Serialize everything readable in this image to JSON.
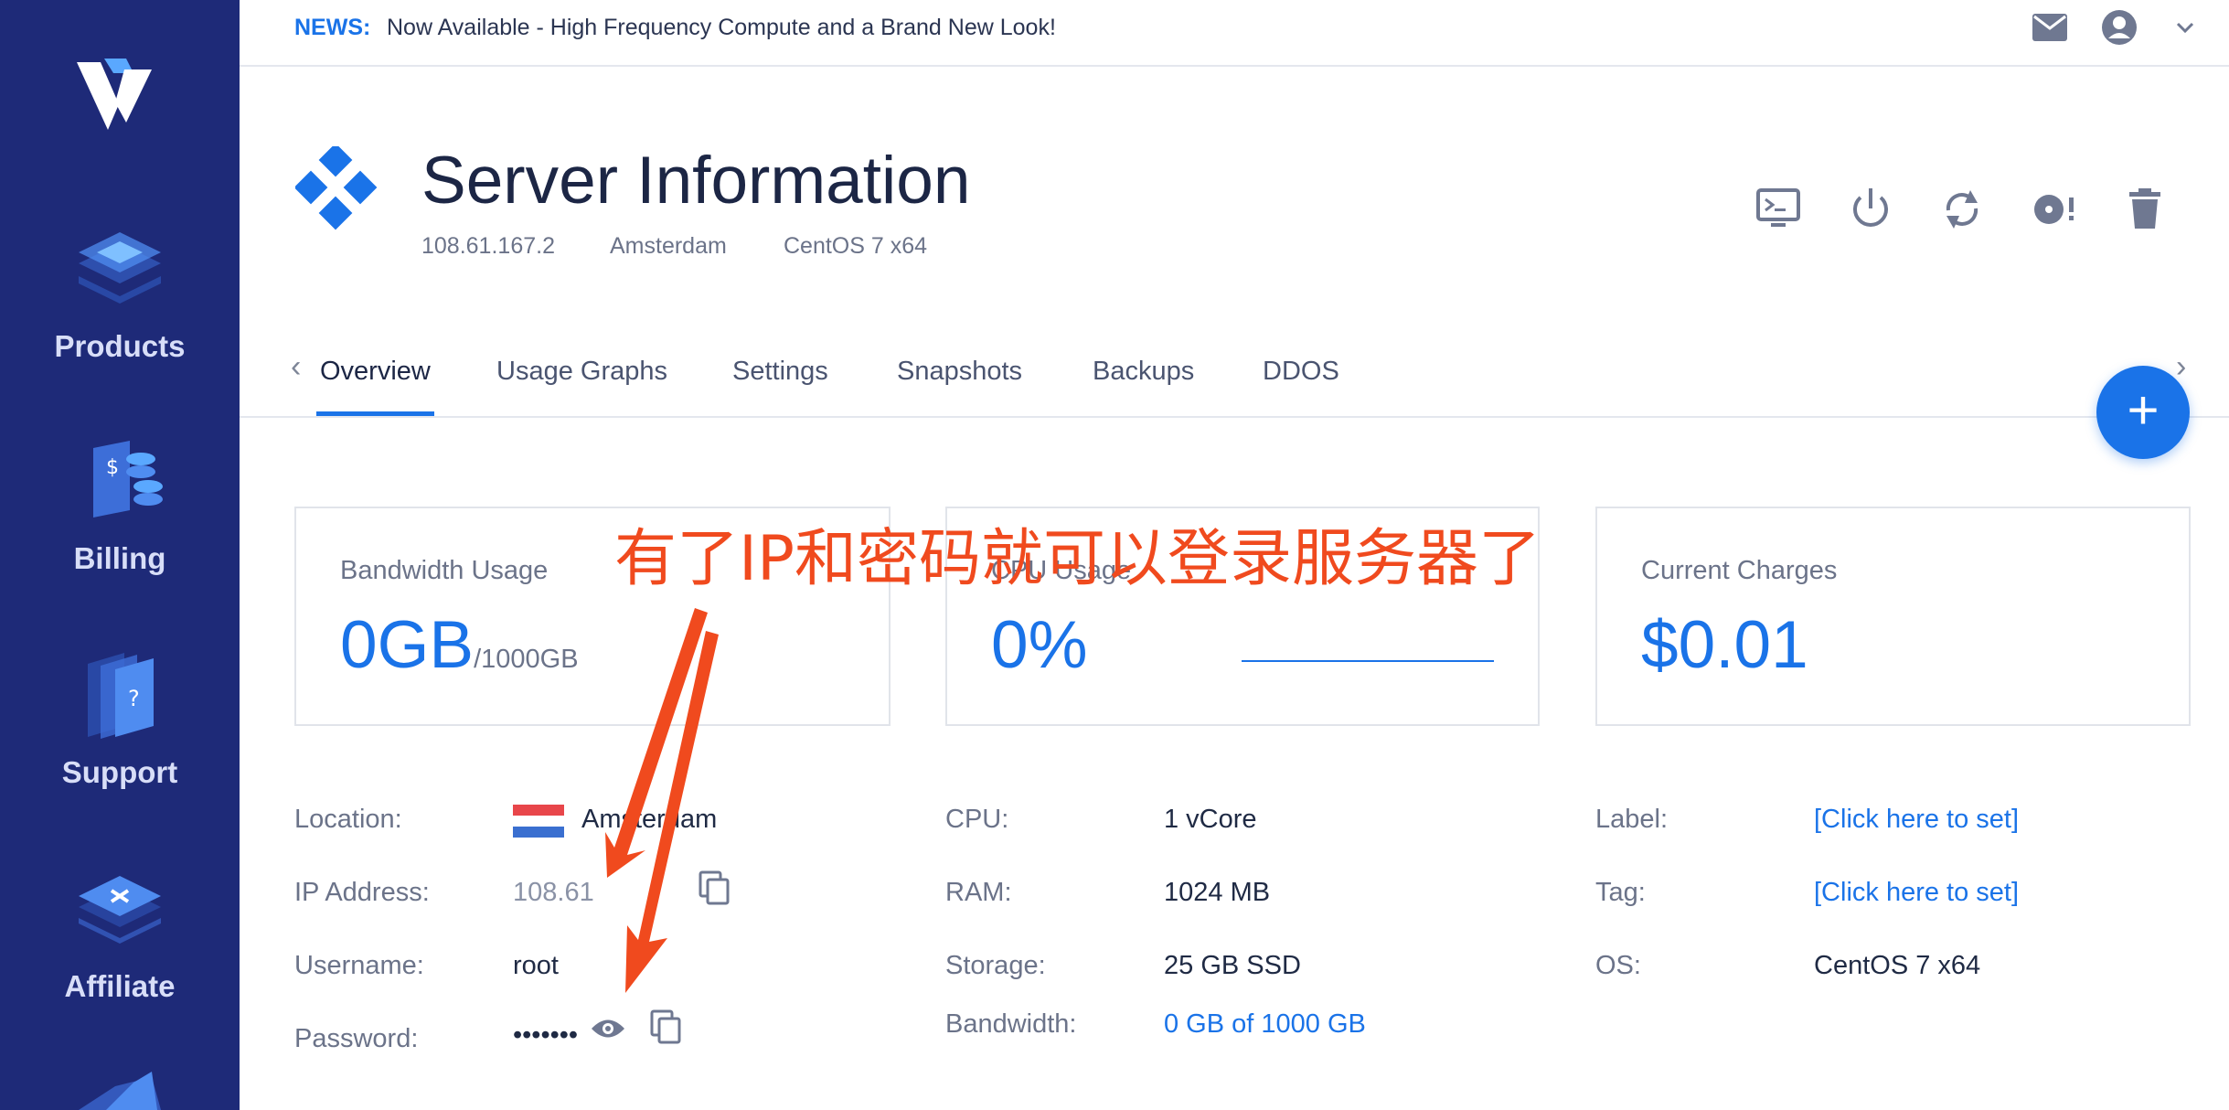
{
  "sidebar": {
    "logo_icon": "vultr-logo-icon",
    "items": [
      {
        "label": "Products",
        "icon": "products-stack-icon"
      },
      {
        "label": "Billing",
        "icon": "billing-icon"
      },
      {
        "label": "Support",
        "icon": "support-icon"
      },
      {
        "label": "Affiliate",
        "icon": "affiliate-icon"
      }
    ]
  },
  "topbar": {
    "news_tag": "NEWS:",
    "news_text": "Now Available - High Frequency Compute and a Brand New Look!",
    "icons": [
      "mail-icon",
      "account-icon",
      "chevron-down-icon"
    ]
  },
  "header": {
    "title": "Server Information",
    "ip": "108.61.167.2",
    "location": "Amsterdam",
    "os": "CentOS 7 x64",
    "actions": [
      "console-icon",
      "power-icon",
      "restart-icon",
      "reinstall-icon",
      "trash-icon"
    ]
  },
  "tabs": [
    "Overview",
    "Usage Graphs",
    "Settings",
    "Snapshots",
    "Backups",
    "DDOS"
  ],
  "fab_label": "+",
  "cards": {
    "bandwidth": {
      "label": "Bandwidth Usage",
      "value": "0GB",
      "sub": "/1000GB"
    },
    "cpu": {
      "label": "CPU Usage",
      "value": "0%"
    },
    "charges": {
      "label": "Current Charges",
      "value": "$0.01"
    }
  },
  "details": {
    "location": {
      "label": "Location:",
      "value": "Amsterdam"
    },
    "ip": {
      "label": "IP Address:",
      "value": "108.61"
    },
    "username": {
      "label": "Username:",
      "value": "root"
    },
    "password": {
      "label": "Password:",
      "value": "•••••••"
    },
    "cpu": {
      "label": "CPU:",
      "value": "1 vCore"
    },
    "ram": {
      "label": "RAM:",
      "value": "1024 MB"
    },
    "storage": {
      "label": "Storage:",
      "value": "25 GB SSD"
    },
    "bandwidth": {
      "label": "Bandwidth:",
      "value": "0 GB of 1000 GB"
    },
    "label": {
      "label": "Label:",
      "value": "[Click here to set]"
    },
    "tag": {
      "label": "Tag:",
      "value": "[Click here to set]"
    },
    "os": {
      "label": "OS:",
      "value": "CentOS 7 x64"
    }
  },
  "annotation": "有了IP和密码就可以登录服务器了",
  "colors": {
    "sidebar": "#1e2a78",
    "accent": "#1a73e8",
    "annotation": "#f04a1e"
  }
}
